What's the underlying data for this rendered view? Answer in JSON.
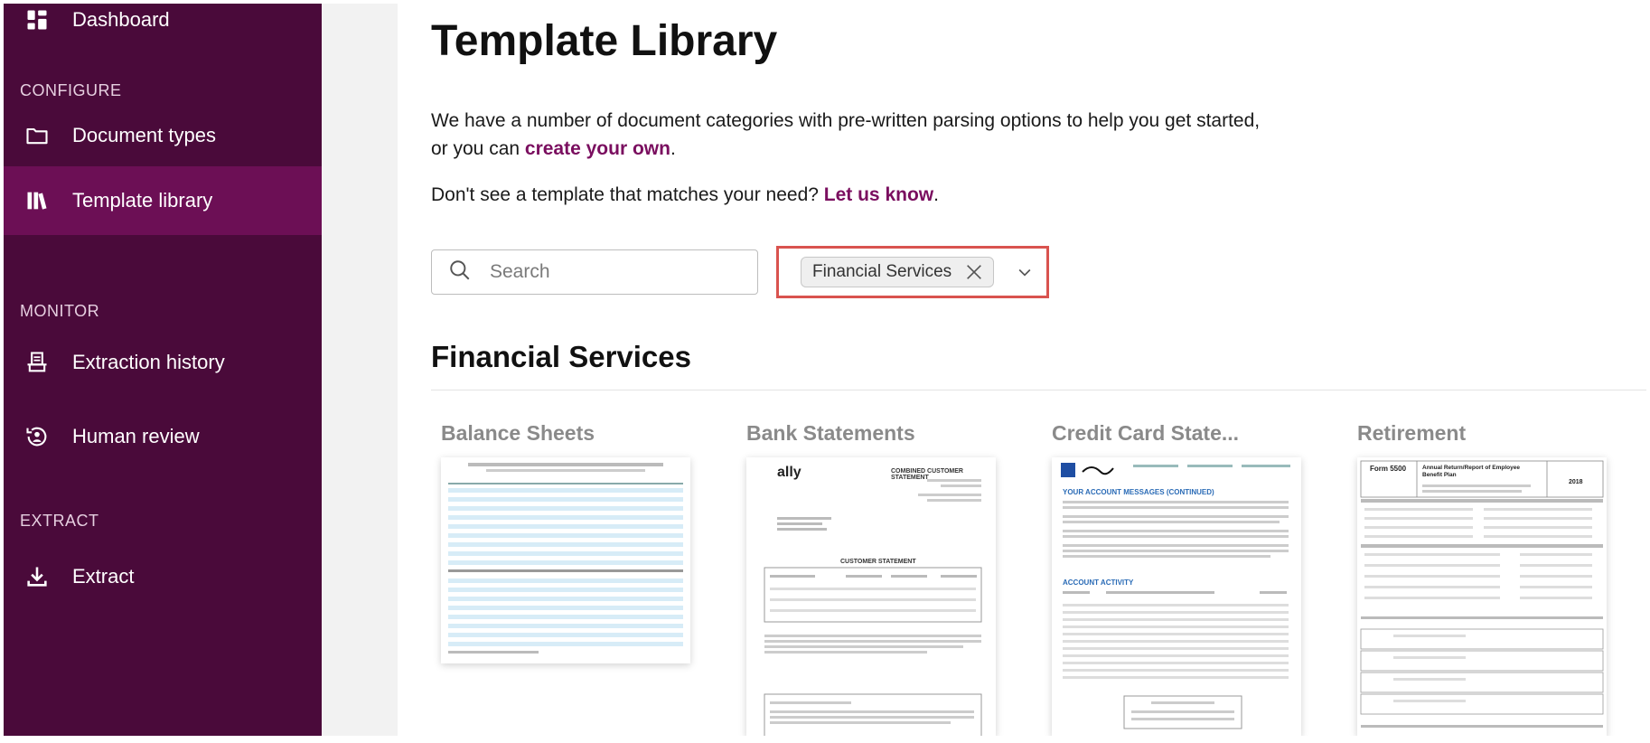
{
  "sidebar": {
    "items": [
      {
        "label": "Dashboard",
        "icon": "dashboard-icon"
      },
      {
        "label": "Document types",
        "icon": "folder-icon"
      },
      {
        "label": "Template library",
        "icon": "library-icon"
      },
      {
        "label": "Extraction history",
        "icon": "history-icon"
      },
      {
        "label": "Human review",
        "icon": "human-review-icon"
      },
      {
        "label": "Extract",
        "icon": "download-icon"
      }
    ],
    "sections": {
      "configure": "CONFIGURE",
      "monitor": "MONITOR",
      "extract": "EXTRACT"
    },
    "active_item": "Template library"
  },
  "main": {
    "title": "Template Library",
    "intro_text_1": "We have a number of document categories with pre-written parsing options to help you get started,",
    "intro_text_2": "or you can ",
    "intro_link": "create your own",
    "intro_text_3": ".",
    "cta_text": "Don't see a template that matches your need? ",
    "cta_link": "Let us know",
    "cta_text_end": "."
  },
  "search": {
    "placeholder": "Search",
    "value": ""
  },
  "filter": {
    "selected_chip": "Financial Services"
  },
  "section": {
    "heading": "Financial Services"
  },
  "cards": [
    {
      "title": "Balance Sheets"
    },
    {
      "title": "Bank Statements"
    },
    {
      "title": "Credit Card State..."
    },
    {
      "title": "Retirement"
    }
  ],
  "thumbnails": {
    "bank_logo": "ally",
    "bank_header": "COMBINED CUSTOMER STATEMENT",
    "bank_subheader": "CUSTOMER STATEMENT",
    "cc_messages": "YOUR ACCOUNT MESSAGES (CONTINUED)",
    "cc_activity": "ACCOUNT ACTIVITY",
    "ret_form": "Form 5500",
    "ret_title": "Annual Return/Report of Employee Benefit Plan",
    "ret_year": "2018"
  },
  "colors": {
    "sidebar_bg": "#4a0a3a",
    "sidebar_active": "#6c0f55",
    "link": "#7a0e5f",
    "highlight_border": "#d9534f"
  }
}
